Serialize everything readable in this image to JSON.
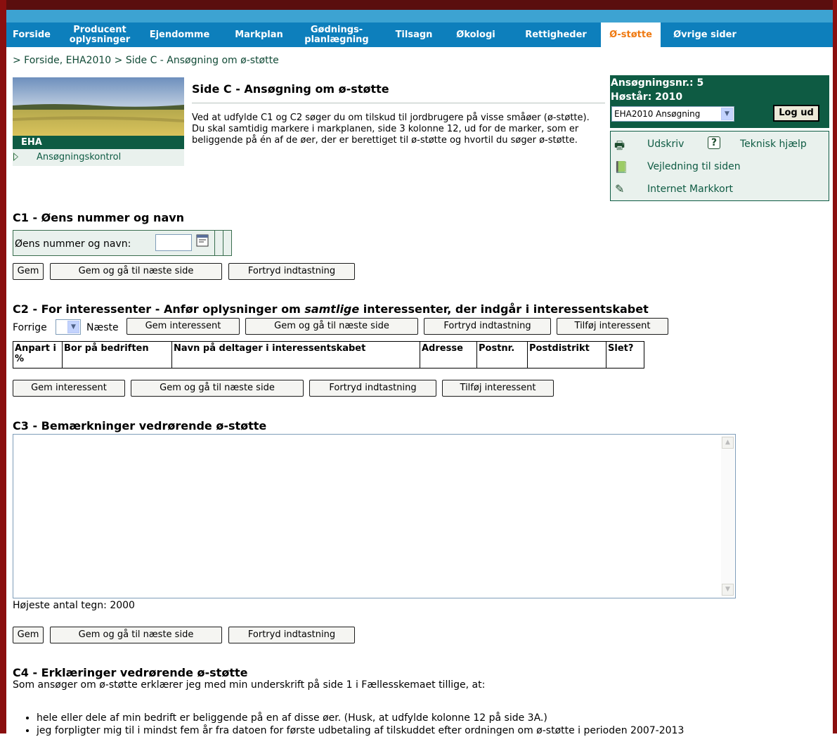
{
  "nav": {
    "items": [
      {
        "label": "Forside"
      },
      {
        "label": "Producent oplysninger"
      },
      {
        "label": "Ejendomme"
      },
      {
        "label": "Markplan"
      },
      {
        "label": "Gødnings- planlægning"
      },
      {
        "label": "Tilsagn"
      },
      {
        "label": "Økologi"
      },
      {
        "label": "Rettigheder"
      },
      {
        "label": "Ø-støtte"
      },
      {
        "label": "Øvrige sider"
      }
    ],
    "active": "Ø-støtte"
  },
  "breadcrumb": "> Forside, EHA2010 > Side C - Ansøgning om ø-støtte",
  "sidebar": {
    "section": "EHA",
    "link": "Ansøgningskontrol"
  },
  "page": {
    "title": "Side C - Ansøgning om ø-støtte",
    "intro": "Ved at udfylde C1 og C2 søger du om tilskud til jordbrugere på visse småøer (ø-støtte). Du skal samtidig markere i markplanen, side 3 kolonne 12, ud for de marker, som er beliggende på én af de øer, der er berettiget til ø-støtte og hvortil du søger ø-støtte."
  },
  "application": {
    "number": "Ansøgningsnr.: 5",
    "year": "Høstår: 2010",
    "selected": "EHA2010 Ansøgning",
    "logout": "Log ud"
  },
  "tools": {
    "print": "Udskriv",
    "help": "Teknisk hjælp",
    "guide": "Vejledning til siden",
    "map": "Internet Markkort"
  },
  "c1": {
    "heading": "C1 - Øens nummer og navn",
    "label": "Øens nummer og navn:",
    "value": ""
  },
  "buttons": {
    "save": "Gem",
    "save_next": "Gem og gå til næste side",
    "cancel": "Fortryd indtastning",
    "save_interest": "Gem interessent",
    "add_interest": "Tilføj interessent"
  },
  "c2": {
    "heading_pre": "C2 - For interessenter - Anfør oplysninger om ",
    "heading_em": "samtlige",
    "heading_post": " interessenter, der indgår i interessentskabet",
    "prev": "Forrige",
    "next": "Næste",
    "columns": [
      "Anpart i %",
      "Bor på bedriften",
      "Navn på deltager i interessentskabet",
      "Adresse",
      "Postnr.",
      "Postdistrikt",
      "Slet?"
    ]
  },
  "c3": {
    "heading": "C3 - Bemærkninger vedrørende ø-støtte",
    "maxchars": "Højeste antal tegn: 2000"
  },
  "c4": {
    "heading": "C4 - Erklæringer vedrørende ø-støtte",
    "intro": "Som ansøger om ø-støtte erklærer jeg med min underskrift på side 1 i Fællesskemaet tillige, at:",
    "bullets": [
      "hele eller dele af min bedrift er beliggende på en af disse øer. (Husk, at udfylde kolonne 12 på side 3A.)",
      "jeg forpligter mig til i mindst fem år fra datoen for første udbetaling af tilskuddet efter ordningen om ø-støtte i perioden 2007-2013"
    ]
  }
}
